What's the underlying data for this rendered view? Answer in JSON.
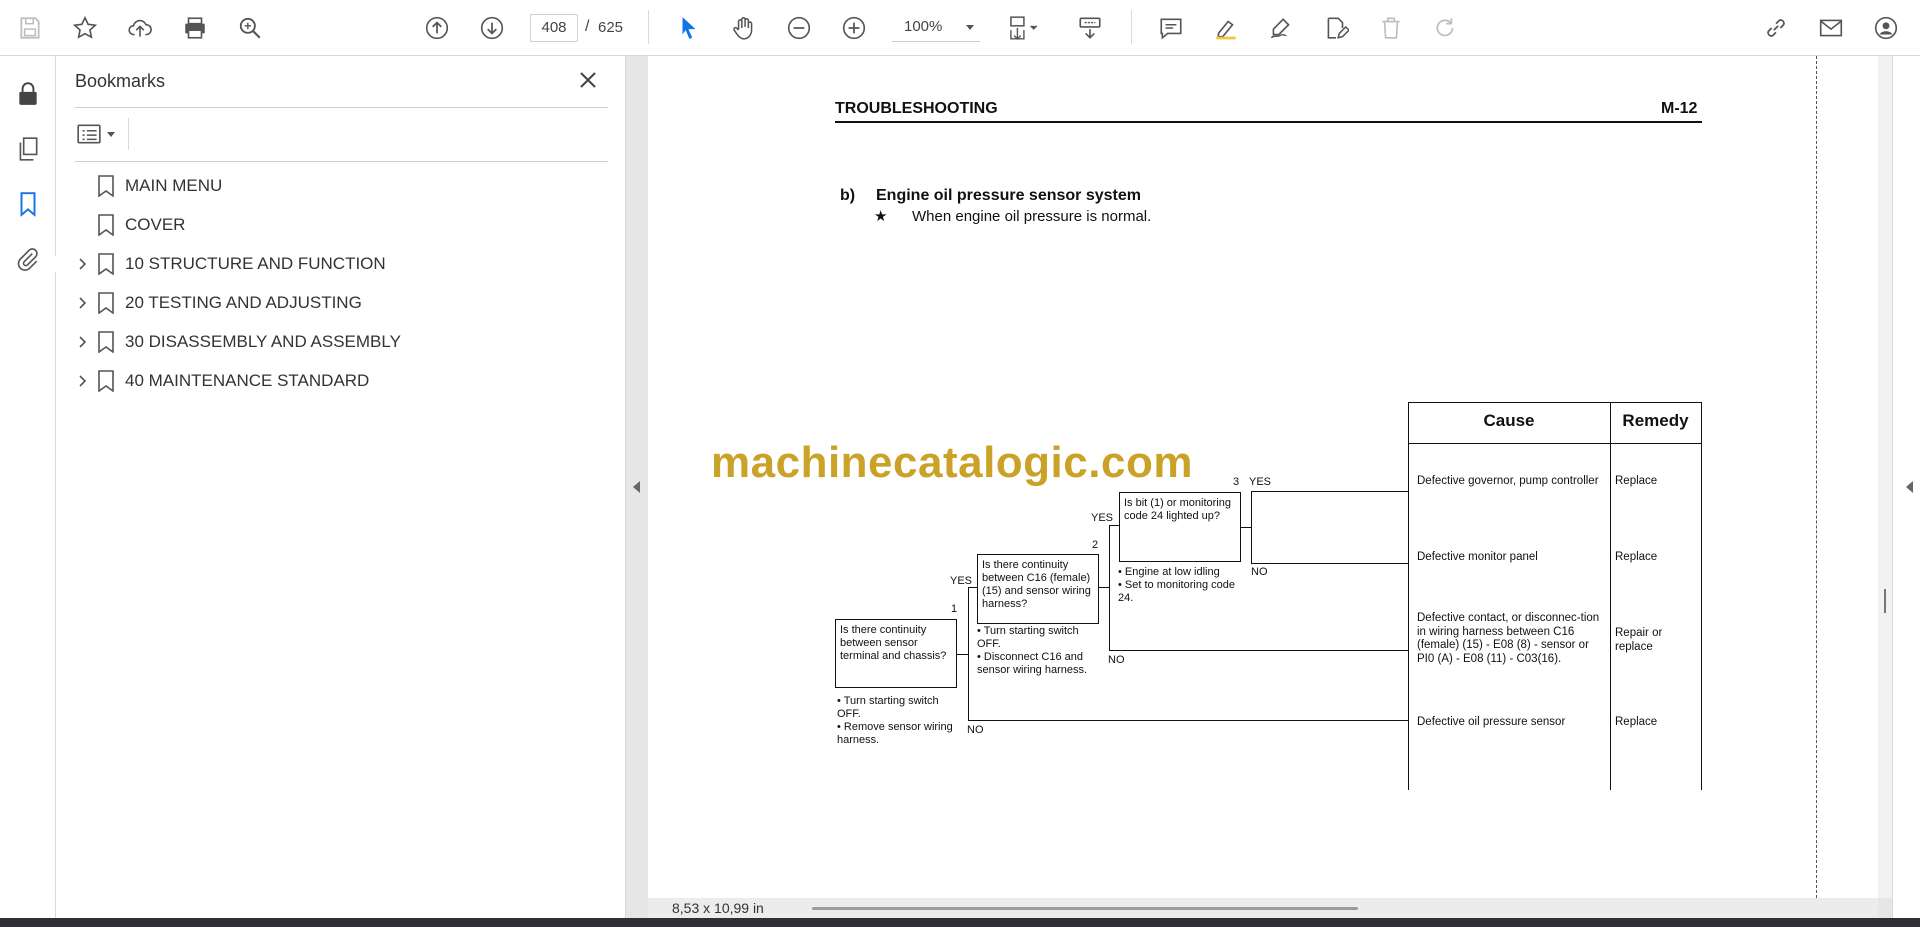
{
  "toolbar": {
    "icons": [
      "save-icon",
      "bookmark-star-icon",
      "upload-icon",
      "print-icon",
      "find-icon",
      "page-up-icon",
      "page-down-icon",
      "select-cursor-icon",
      "hand-icon",
      "zoom-out-icon",
      "zoom-in-icon",
      "fit-page-icon",
      "scroll-mode-icon",
      "comment-icon",
      "highlight-icon",
      "sign-icon",
      "edit-icon",
      "delete-icon",
      "redo-icon",
      "share-link-icon",
      "email-icon",
      "account-icon"
    ],
    "current_page": "408",
    "page_sep": "/",
    "total_pages": "625",
    "zoom": "100%"
  },
  "bookmarks": {
    "title": "Bookmarks",
    "items": [
      {
        "label": "MAIN MENU",
        "expandable": false
      },
      {
        "label": "COVER",
        "expandable": false
      },
      {
        "label": "10 STRUCTURE AND FUNCTION",
        "expandable": true
      },
      {
        "label": "20 TESTING AND ADJUSTING",
        "expandable": true
      },
      {
        "label": "30 DISASSEMBLY AND ASSEMBLY",
        "expandable": true
      },
      {
        "label": "40 MAINTENANCE STANDARD",
        "expandable": true
      }
    ]
  },
  "document": {
    "header_left": "TROUBLESHOOTING",
    "header_right": "M-12",
    "section_letter": "b)",
    "section_title": "Engine oil pressure sensor system",
    "note_star": "★",
    "note": "When engine oil pressure is normal.",
    "watermark": "machinecatalogic.com",
    "flow": {
      "q1": {
        "num": "1",
        "text": "Is there continuity between sensor terminal and chassis?",
        "bullets": [
          "Turn starting switch OFF.",
          "Remove sensor wiring harness."
        ]
      },
      "q2": {
        "num": "2",
        "text": "Is there continuity between C16 (female) (15) and sensor wiring harness?",
        "bullets": [
          "Turn starting switch OFF.",
          "Disconnect C16 and sensor wiring harness."
        ]
      },
      "q3": {
        "num": "3",
        "text": "Is bit (1) or monitoring code 24 lighted up?",
        "bullets": [
          "Engine at low idling",
          "Set to monitoring code 24."
        ]
      },
      "yes": "YES",
      "no": "NO"
    },
    "table": {
      "cause_header": "Cause",
      "remedy_header": "Remedy",
      "rows": [
        {
          "cause": "Defective governor, pump controller",
          "remedy": "Replace"
        },
        {
          "cause": "Defective monitor panel",
          "remedy": "Replace"
        },
        {
          "cause": "Defective contact, or disconnec-tion in wiring harness between C16 (female) (15) - E08 (8) - sensor or PI0 (A) - E08 (11) - C03(16).",
          "remedy": "Repair or replace"
        },
        {
          "cause": "Defective oil pressure sensor",
          "remedy": "Replace"
        }
      ]
    }
  },
  "status": {
    "page_size": "8,53 x 10,99 in"
  }
}
